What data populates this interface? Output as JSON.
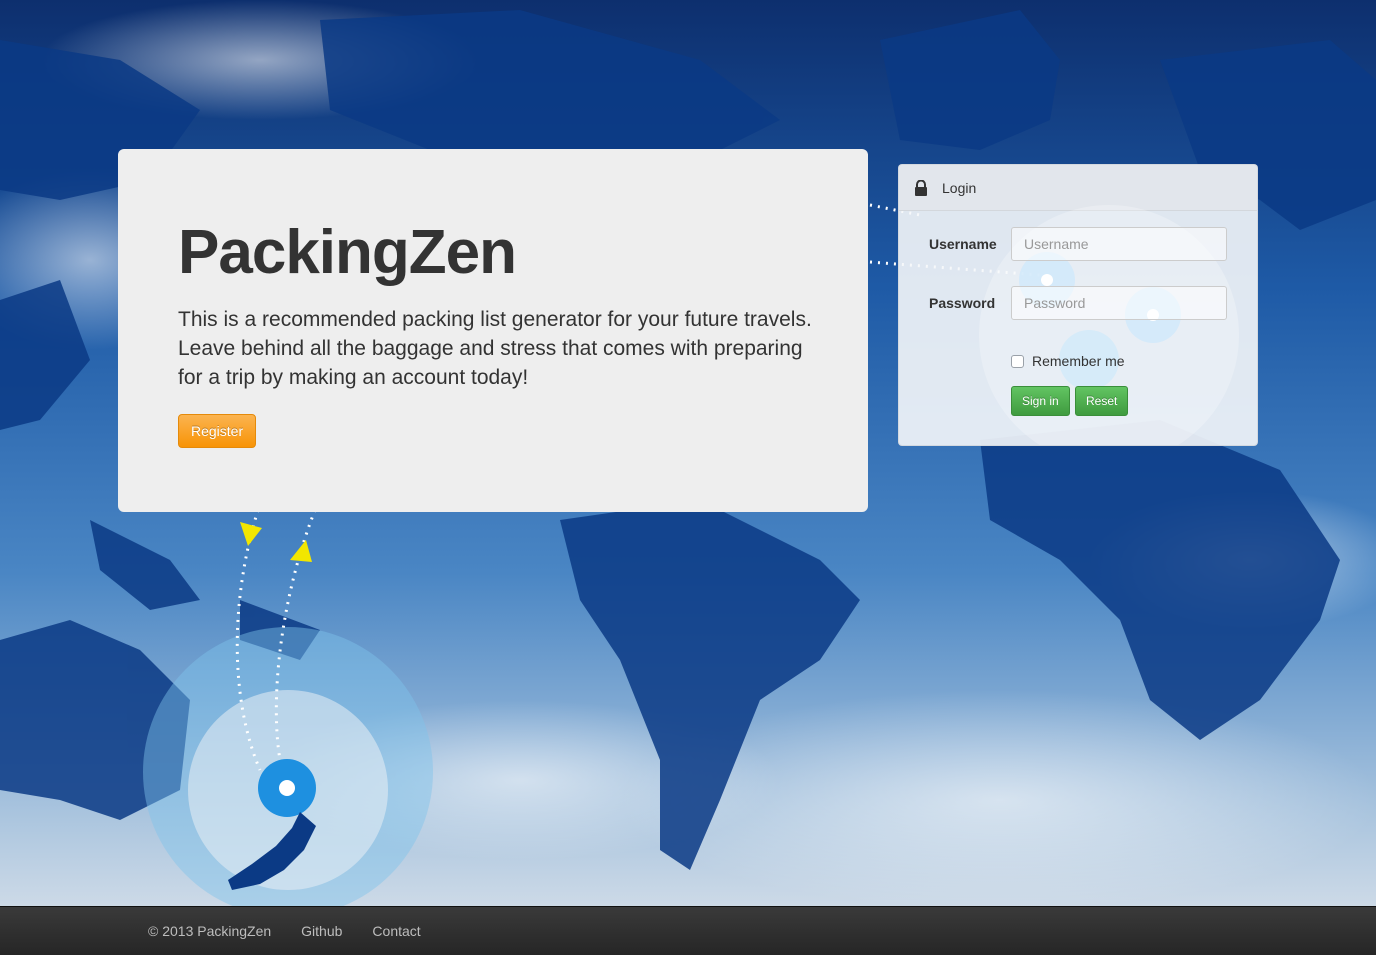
{
  "hero": {
    "title": "PackingZen",
    "description": "This is a recommended packing list generator for your future travels. Leave behind all the baggage and stress that comes with preparing for a trip by making an account today!",
    "register_label": "Register"
  },
  "login": {
    "header_icon": "lock-icon",
    "header_title": "Login",
    "username_label": "Username",
    "username_placeholder": "Username",
    "password_label": "Password",
    "password_placeholder": "Password",
    "remember_label": "Remember me",
    "sign_in_label": "Sign in",
    "reset_label": "Reset"
  },
  "footer": {
    "copyright": "© 2013 PackingZen",
    "links": [
      "Github",
      "Contact"
    ]
  },
  "colors": {
    "register_button": "#f89406",
    "action_button": "#51a351",
    "footer_bg": "#2e2e2e",
    "hero_bg": "#eeeeee"
  }
}
